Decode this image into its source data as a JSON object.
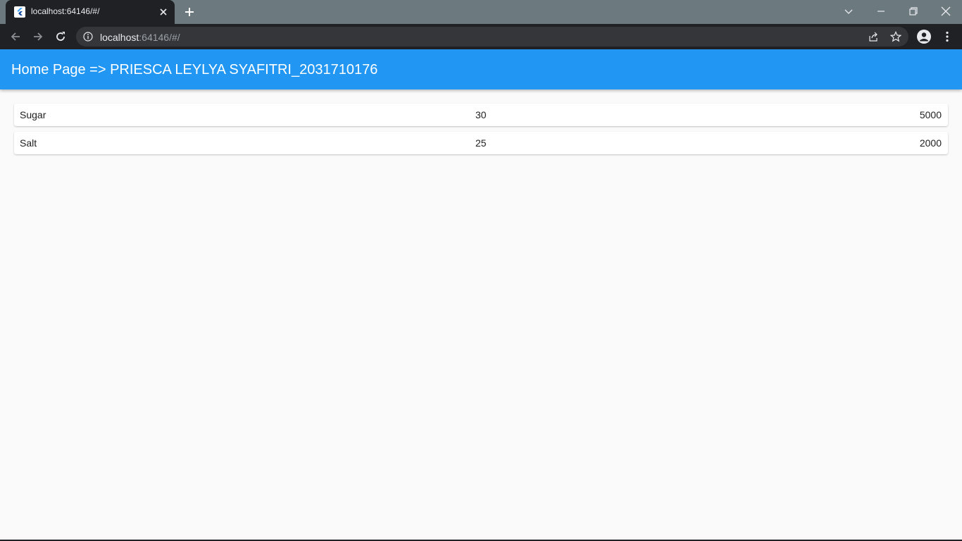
{
  "browser": {
    "tab_title": "localhost:64146/#/",
    "url_host": "localhost",
    "url_rest": ":64146/#/",
    "icons": [
      "flutter-favicon",
      "close-icon",
      "plus-icon",
      "chevron-down-icon",
      "minimize-icon",
      "restore-icon",
      "close-window-icon",
      "back-arrow-icon",
      "forward-arrow-icon",
      "reload-icon",
      "info-icon",
      "share-icon",
      "star-icon",
      "profile-icon",
      "kebab-menu-icon"
    ]
  },
  "appbar": {
    "title": "Home Page => PRIESCA LEYLYA SYAFITRI_2031710176",
    "color": "#2196f3"
  },
  "items": [
    {
      "name": "Sugar",
      "qty": "30",
      "price": "5000"
    },
    {
      "name": "Salt",
      "qty": "25",
      "price": "2000"
    }
  ]
}
